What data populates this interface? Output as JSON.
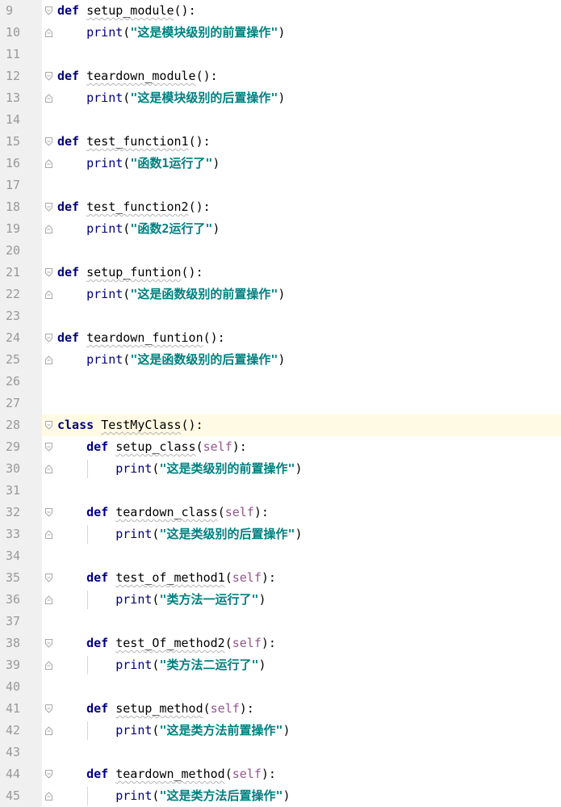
{
  "editor": {
    "current_line": 28,
    "lines": [
      {
        "n": "9",
        "segments": [
          [
            "kw",
            "def"
          ],
          [
            "",
            "",
            " "
          ],
          [
            "fn",
            "setup_module"
          ],
          [
            "",
            "()"
          ],
          [
            "",
            ":"
          ]
        ]
      },
      {
        "n": "10",
        "segments": [
          [
            "",
            "    "
          ],
          [
            "blt",
            "print"
          ],
          [
            "",
            "("
          ],
          [
            "str",
            "\"这是模块级别的前置操作\""
          ],
          [
            "",
            ")"
          ]
        ]
      },
      {
        "n": "11",
        "segments": []
      },
      {
        "n": "12",
        "segments": [
          [
            "kw",
            "def"
          ],
          [
            "",
            " "
          ],
          [
            "fn",
            "teardown_module"
          ],
          [
            "",
            "():"
          ]
        ]
      },
      {
        "n": "13",
        "segments": [
          [
            "",
            "    "
          ],
          [
            "blt",
            "print"
          ],
          [
            "",
            "("
          ],
          [
            "str",
            "\"这是模块级别的后置操作\""
          ],
          [
            "",
            ")"
          ]
        ]
      },
      {
        "n": "14",
        "segments": []
      },
      {
        "n": "15",
        "segments": [
          [
            "kw",
            "def"
          ],
          [
            "",
            " "
          ],
          [
            "fn",
            "test_function1"
          ],
          [
            "",
            "():"
          ]
        ]
      },
      {
        "n": "16",
        "segments": [
          [
            "",
            "    "
          ],
          [
            "blt",
            "print"
          ],
          [
            "",
            "("
          ],
          [
            "str",
            "\"函数1运行了\""
          ],
          [
            "",
            ")"
          ]
        ]
      },
      {
        "n": "17",
        "segments": []
      },
      {
        "n": "18",
        "segments": [
          [
            "kw",
            "def"
          ],
          [
            "",
            " "
          ],
          [
            "fn",
            "test_function2"
          ],
          [
            "",
            "():"
          ]
        ]
      },
      {
        "n": "19",
        "segments": [
          [
            "",
            "    "
          ],
          [
            "blt",
            "print"
          ],
          [
            "",
            "("
          ],
          [
            "str",
            "\"函数2运行了\""
          ],
          [
            "",
            ")"
          ]
        ]
      },
      {
        "n": "20",
        "segments": []
      },
      {
        "n": "21",
        "segments": [
          [
            "kw",
            "def"
          ],
          [
            "",
            " "
          ],
          [
            "fn",
            "setup_funtion"
          ],
          [
            "",
            "():"
          ]
        ]
      },
      {
        "n": "22",
        "segments": [
          [
            "",
            "    "
          ],
          [
            "blt",
            "print"
          ],
          [
            "",
            "("
          ],
          [
            "str",
            "\"这是函数级别的前置操作\""
          ],
          [
            "",
            ")"
          ]
        ]
      },
      {
        "n": "23",
        "segments": []
      },
      {
        "n": "24",
        "segments": [
          [
            "kw",
            "def"
          ],
          [
            "",
            " "
          ],
          [
            "fn",
            "teardown_funtion"
          ],
          [
            "",
            "():"
          ]
        ]
      },
      {
        "n": "25",
        "segments": [
          [
            "",
            "    "
          ],
          [
            "blt",
            "print"
          ],
          [
            "",
            "("
          ],
          [
            "str",
            "\"这是函数级别的后置操作\""
          ],
          [
            "",
            ")"
          ]
        ]
      },
      {
        "n": "26",
        "segments": []
      },
      {
        "n": "27",
        "segments": []
      },
      {
        "n": "28",
        "segments": [
          [
            "kw",
            "class"
          ],
          [
            "",
            " "
          ],
          [
            "fn",
            "TestMyClass"
          ],
          [
            "",
            "():"
          ]
        ]
      },
      {
        "n": "29",
        "segments": [
          [
            "",
            "    "
          ],
          [
            "kw",
            "def"
          ],
          [
            "",
            " "
          ],
          [
            "fn",
            "setup_class"
          ],
          [
            "",
            "("
          ],
          [
            "self",
            "self"
          ],
          [
            "",
            "):"
          ]
        ]
      },
      {
        "n": "30",
        "segments": [
          [
            "",
            "        "
          ],
          [
            "blt",
            "print"
          ],
          [
            "",
            "("
          ],
          [
            "str",
            "\"这是类级别的前置操作\""
          ],
          [
            "",
            ")"
          ]
        ]
      },
      {
        "n": "31",
        "segments": []
      },
      {
        "n": "32",
        "segments": [
          [
            "",
            "    "
          ],
          [
            "kw",
            "def"
          ],
          [
            "",
            " "
          ],
          [
            "fn",
            "teardown_class"
          ],
          [
            "",
            "("
          ],
          [
            "self",
            "self"
          ],
          [
            "",
            "):"
          ]
        ]
      },
      {
        "n": "33",
        "segments": [
          [
            "",
            "        "
          ],
          [
            "blt",
            "print"
          ],
          [
            "",
            "("
          ],
          [
            "str",
            "\"这是类级别的后置操作\""
          ],
          [
            "",
            ")"
          ]
        ]
      },
      {
        "n": "34",
        "segments": []
      },
      {
        "n": "35",
        "segments": [
          [
            "",
            "    "
          ],
          [
            "kw",
            "def"
          ],
          [
            "",
            " "
          ],
          [
            "fn",
            "test_of_method1"
          ],
          [
            "",
            "("
          ],
          [
            "self",
            "self"
          ],
          [
            "",
            "):"
          ]
        ]
      },
      {
        "n": "36",
        "segments": [
          [
            "",
            "        "
          ],
          [
            "blt",
            "print"
          ],
          [
            "",
            "("
          ],
          [
            "str",
            "\"类方法一运行了\""
          ],
          [
            "",
            ")"
          ]
        ]
      },
      {
        "n": "37",
        "segments": []
      },
      {
        "n": "38",
        "segments": [
          [
            "",
            "    "
          ],
          [
            "kw",
            "def"
          ],
          [
            "",
            " "
          ],
          [
            "fn",
            "test_Of_method2"
          ],
          [
            "",
            "("
          ],
          [
            "self",
            "self"
          ],
          [
            "",
            "):"
          ]
        ]
      },
      {
        "n": "39",
        "segments": [
          [
            "",
            "        "
          ],
          [
            "blt",
            "print"
          ],
          [
            "",
            "("
          ],
          [
            "str",
            "\"类方法二运行了\""
          ],
          [
            "",
            ")"
          ]
        ]
      },
      {
        "n": "40",
        "segments": []
      },
      {
        "n": "41",
        "segments": [
          [
            "",
            "    "
          ],
          [
            "kw",
            "def"
          ],
          [
            "",
            " "
          ],
          [
            "fn",
            "setup_method"
          ],
          [
            "",
            "("
          ],
          [
            "self",
            "self"
          ],
          [
            "",
            "):"
          ]
        ]
      },
      {
        "n": "42",
        "segments": [
          [
            "",
            "        "
          ],
          [
            "blt",
            "print"
          ],
          [
            "",
            "("
          ],
          [
            "str",
            "\"这是类方法前置操作\""
          ],
          [
            "",
            ")"
          ]
        ]
      },
      {
        "n": "43",
        "segments": []
      },
      {
        "n": "44",
        "segments": [
          [
            "",
            "    "
          ],
          [
            "kw",
            "def"
          ],
          [
            "",
            " "
          ],
          [
            "fn",
            "teardown_method"
          ],
          [
            "",
            "("
          ],
          [
            "self",
            "self"
          ],
          [
            "",
            "):"
          ]
        ]
      },
      {
        "n": "45",
        "segments": [
          [
            "",
            "        "
          ],
          [
            "blt",
            "print"
          ],
          [
            "",
            "("
          ],
          [
            "str",
            "\"这是类方法后置操作\""
          ],
          [
            "",
            ")"
          ]
        ]
      }
    ]
  },
  "colors": {
    "keyword": "#000080",
    "string": "#008080",
    "self": "#94558d",
    "gutter": "#f0f0f0",
    "line_number": "#999999",
    "current_line": "#fffae3"
  }
}
